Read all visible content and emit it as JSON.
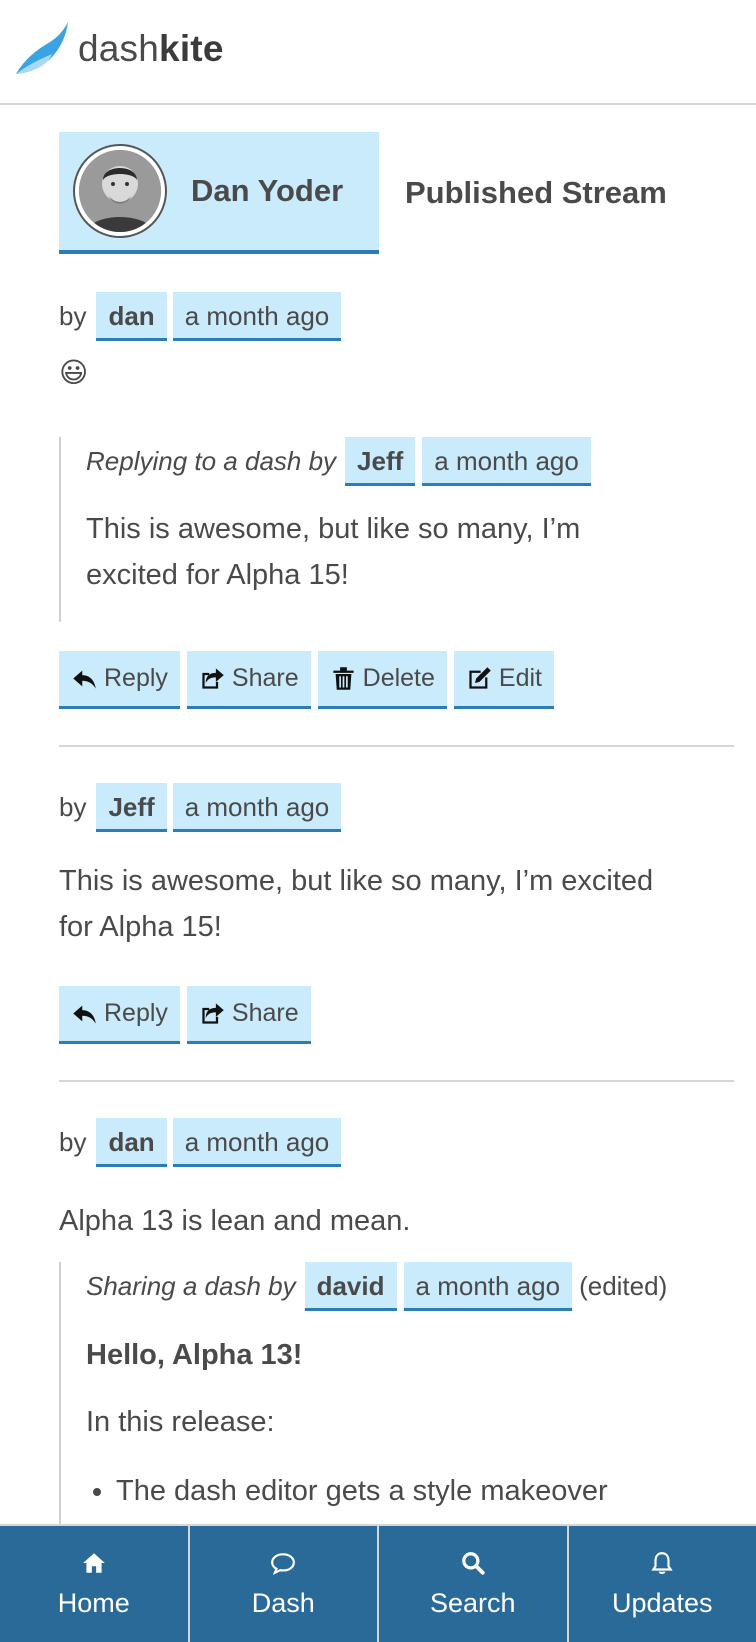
{
  "brand": {
    "name_light": "dash",
    "name_bold": "kite"
  },
  "profile": {
    "name": "Dan Yoder",
    "stream_title": "Published Stream"
  },
  "posts": [
    {
      "by": "by",
      "author": "dan",
      "time": "a month ago",
      "emoji": "😃",
      "quote": {
        "intro": "Replying to a dash by",
        "author": "Jeff",
        "time": "a month ago",
        "text_line1": "This is awesome, but like so many, I’m",
        "text_line2": "excited for Alpha 15!"
      },
      "actions": {
        "reply": "Reply",
        "share": "Share",
        "delete": "Delete",
        "edit": "Edit"
      }
    },
    {
      "by": "by",
      "author": "Jeff",
      "time": "a month ago",
      "text_line1": "This is awesome, but like so many, I’m excited",
      "text_line2": "for Alpha 15!",
      "actions": {
        "reply": "Reply",
        "share": "Share"
      }
    },
    {
      "by": "by",
      "author": "dan",
      "time": "a month ago",
      "text": "Alpha 13 is lean and mean.",
      "quote": {
        "intro": "Sharing a dash by",
        "author": "david",
        "time": "a month ago",
        "edited": "(edited)",
        "heading": "Hello, Alpha 13!",
        "para": "In this release:",
        "bullet1": "The dash editor gets a style makeover"
      }
    }
  ],
  "tabs": {
    "home": "Home",
    "dash": "Dash",
    "search": "Search",
    "updates": "Updates"
  },
  "colors": {
    "accent": "#2c7db5",
    "tag_bg": "#c9ebfc",
    "tabbar": "#296a99"
  }
}
